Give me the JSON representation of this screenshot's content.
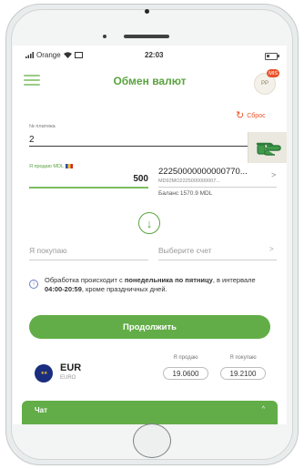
{
  "status_bar": {
    "carrier": "Orange",
    "time": "22:03",
    "battery_level": 0.3
  },
  "header": {
    "title": "Обмен валют",
    "avatar_initials": "PP",
    "avatar_badge": "MIS"
  },
  "form": {
    "reset_label": "Сброс",
    "payment_label": "№ платежа",
    "payment_value": "2",
    "sell_label": "Я продаю MDL",
    "sell_amount": "500",
    "account_number": "22250000000000770...",
    "account_sub": "MD92MO2225000000007...",
    "balance": "Баланс 1570.9 MDL",
    "buy_placeholder": "Я покупаю",
    "choose_account_placeholder": "Выберите счет",
    "info_text_before": "Обработка происходит с ",
    "info_text_bold": "понедельника по пятницу",
    "info_text_mid": ", в интервале ",
    "info_text_time": "04:00-20:59",
    "info_text_after": ", кроме праздничных дней.",
    "continue_label": "Продолжить"
  },
  "rates": {
    "sell_header": "Я продаю",
    "buy_header": "Я покупаю",
    "currency_code": "EUR",
    "currency_name": "EURO",
    "sell_rate": "19.0600",
    "buy_rate": "19.2100"
  },
  "chat": {
    "label": "Чат"
  },
  "icons": {
    "menu": "menu-icon",
    "reset": "refresh-icon",
    "fingerprint": "pointing-hand-icon",
    "swap": "arrow-down-icon",
    "info": "info-icon",
    "chat_toggle": "chevron-up-icon"
  },
  "colors": {
    "accent": "#62ad47",
    "reset": "#e8542b",
    "title": "#5aa33f"
  }
}
